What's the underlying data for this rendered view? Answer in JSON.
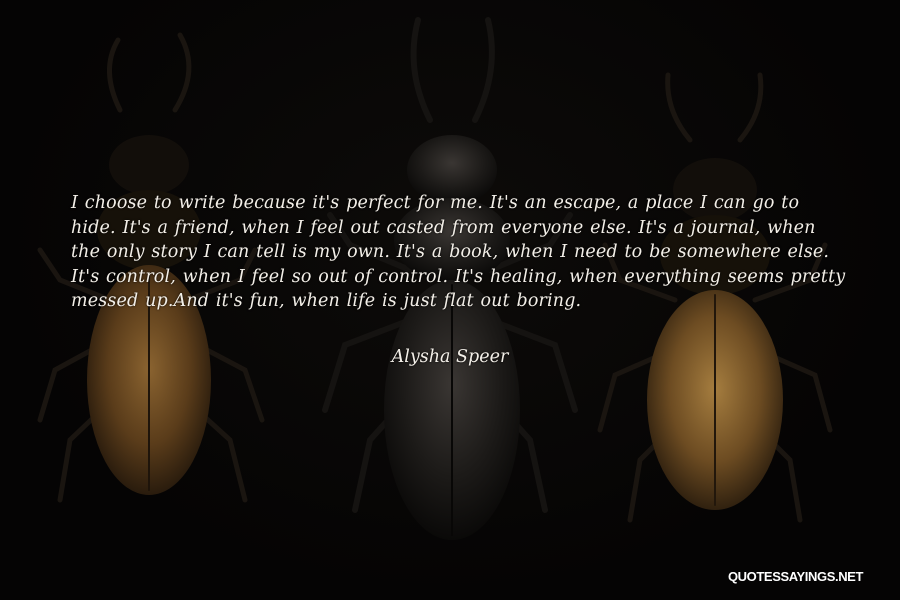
{
  "quote": {
    "text": "I choose to write because it's perfect for me. It's an escape, a place I can go to hide. It's a friend, when I feel out casted from everyone else. It's a journal, when the only story I can tell is my own. It's a book, when I need to be somewhere else. It's control, when I feel so out of control. It's healing, when everything seems pretty messed up.And it's fun, when life is just flat out boring.",
    "author": "Alysha Speer"
  },
  "watermark": "QUOTESSAYINGS.NET",
  "colors": {
    "background": "#050404",
    "text": "#f3efe8",
    "beetle_shell": "#6b4a22",
    "beetle_highlight": "#a07a3e",
    "beetle_dark": "#1a1510"
  },
  "illustration": "three-stag-beetles"
}
